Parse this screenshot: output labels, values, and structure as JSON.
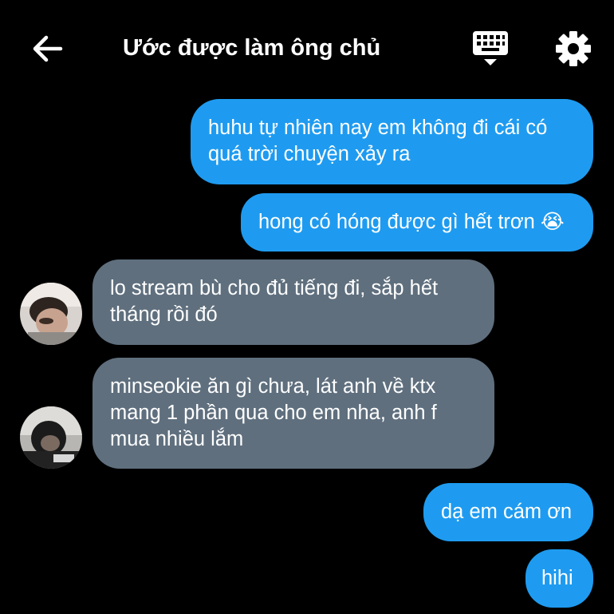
{
  "header": {
    "title": "Ước được làm ông chủ",
    "back_icon": "arrow-left-icon",
    "keyboard_icon": "keyboard-icon",
    "settings_icon": "gear-icon"
  },
  "colors": {
    "background": "#000000",
    "sent_bubble": "#1e9bf0",
    "received_bubble": "#5f6f7e"
  },
  "messages": [
    {
      "sender": "me",
      "text": "huhu tự nhiên nay em không đi cái có quá trời chuyện xảy ra"
    },
    {
      "sender": "me",
      "text": "hong có hóng được gì hết trơn 😭"
    },
    {
      "sender": "other",
      "text": "lo stream bù cho đủ tiếng đi, sắp hết tháng rồi đó"
    },
    {
      "sender": "other",
      "text": "minseokie ăn gì chưa, lát anh về ktx mang 1 phần qua cho em nha, anh f mua nhiều lắm"
    },
    {
      "sender": "me",
      "text": "dạ em cám ơn"
    },
    {
      "sender": "me",
      "text": "hihi"
    }
  ]
}
